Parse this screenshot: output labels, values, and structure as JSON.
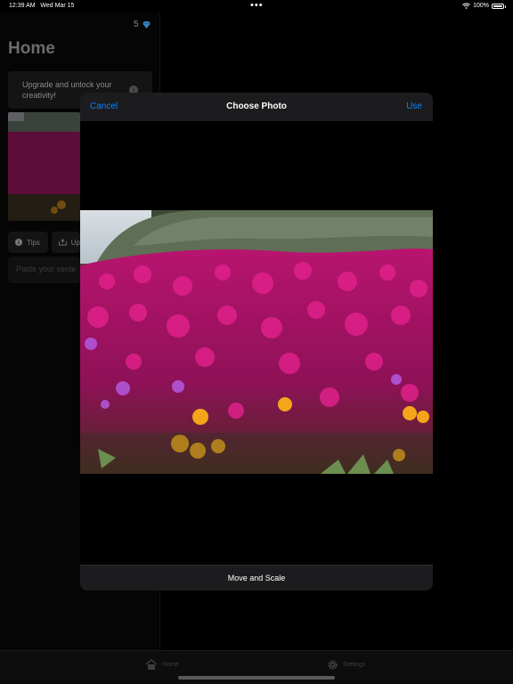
{
  "status_bar": {
    "time": "12:39 AM",
    "date": "Wed Mar 15",
    "battery": "100%",
    "dots": "•••"
  },
  "home": {
    "gem_count": "5",
    "title": "Home",
    "upgrade_text": "Upgrade and unlock your creativity!",
    "chips": {
      "tips": "Tips",
      "upload": "Up"
    },
    "paste_placeholder": "Paste your sente"
  },
  "tabbar": {
    "home": "Home",
    "settings": "Settings"
  },
  "modal": {
    "cancel": "Cancel",
    "title": "Choose Photo",
    "use": "Use",
    "footer": "Move and Scale"
  },
  "colors": {
    "accent": "#0a84ff",
    "sheet_bar": "#1c1c1e",
    "background": "#000000"
  }
}
